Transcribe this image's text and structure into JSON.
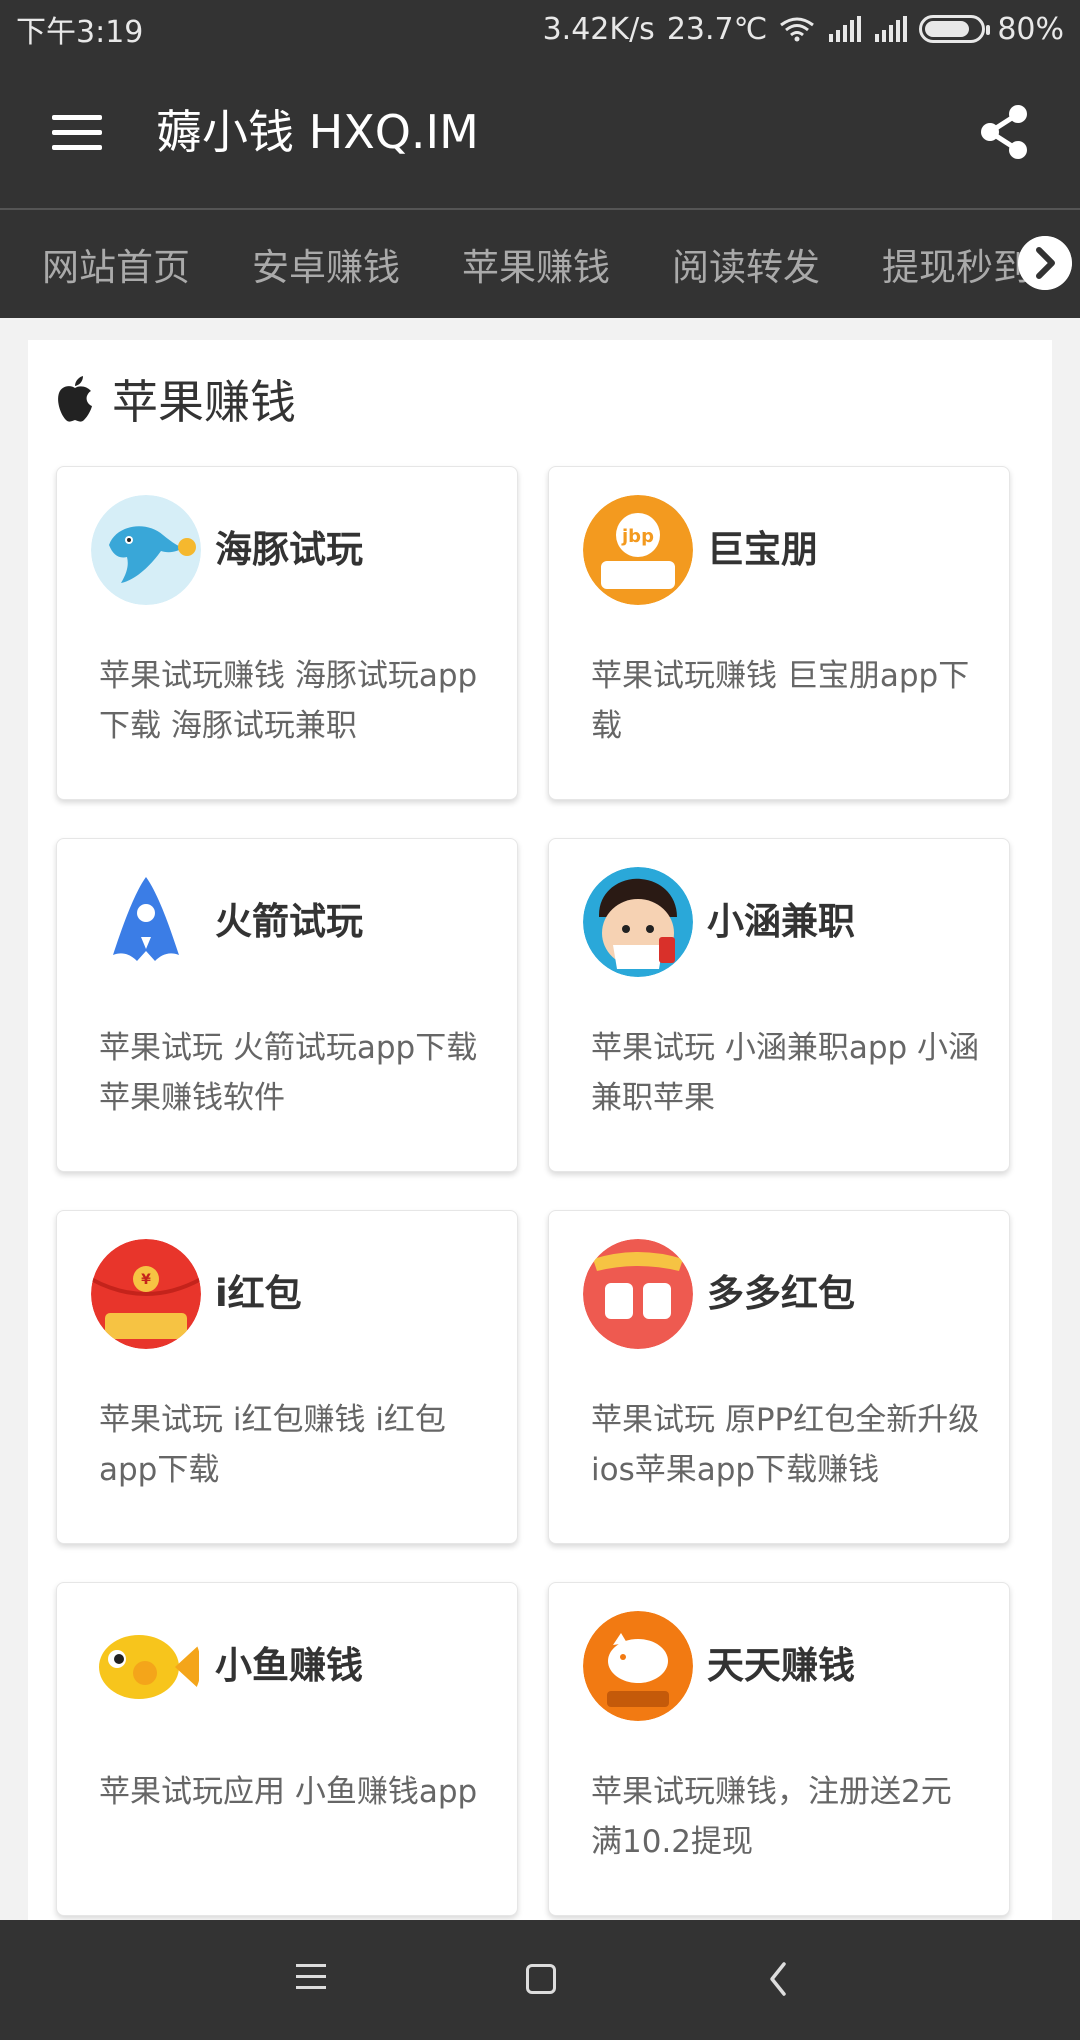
{
  "status_bar": {
    "time": "下午3:19",
    "speed": "3.42K/s",
    "temperature": "23.7℃",
    "battery": "80%",
    "battery_level": 0.8
  },
  "app_bar": {
    "title": "薅小钱 HXQ.IM"
  },
  "nav": {
    "tabs": [
      "网站首页",
      "安卓赚钱",
      "苹果赚钱",
      "阅读转发",
      "提现秒到"
    ]
  },
  "section": {
    "title": "苹果赚钱"
  },
  "apps": [
    {
      "name": "海豚试玩",
      "desc": "苹果试玩赚钱 海豚试玩app下载 海豚试玩兼职",
      "icon": "dolphin-icon",
      "color": "#d6eef7"
    },
    {
      "name": "巨宝朋",
      "desc": "苹果试玩赚钱 巨宝朋app下载",
      "icon": "jubaopeng-icon",
      "color": "#f39a1f"
    },
    {
      "name": "火箭试玩",
      "desc": "苹果试玩 火箭试玩app下载 苹果赚钱软件",
      "icon": "rocket-icon",
      "color": "#3b7de6"
    },
    {
      "name": "小涵兼职",
      "desc": "苹果试玩 小涵兼职app 小涵兼职苹果",
      "icon": "boy-avatar-icon",
      "color": "#2aa8d9"
    },
    {
      "name": "i红包",
      "desc": "苹果试玩 i红包赚钱 i红包app下载",
      "icon": "red-packet-icon",
      "color": "#e8352b"
    },
    {
      "name": "多多红包",
      "desc": "苹果试玩 原PP红包全新升级 ios苹果app下载赚钱",
      "icon": "duoduo-icon",
      "color": "#ee5a50"
    },
    {
      "name": "小鱼赚钱",
      "desc": "苹果试玩应用 小鱼赚钱app",
      "icon": "fish-icon",
      "color": "#f7c51c"
    },
    {
      "name": "天天赚钱",
      "desc": "苹果试玩赚钱，注册送2元满10.2提现",
      "icon": "piggy-bank-icon",
      "color": "#f27a12"
    }
  ]
}
